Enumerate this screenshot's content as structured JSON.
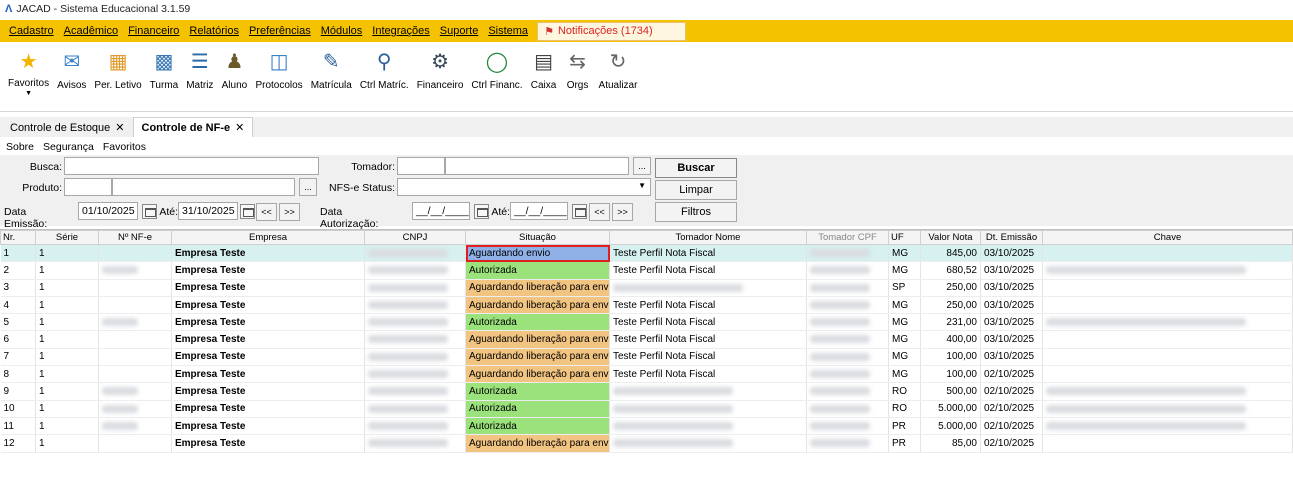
{
  "window": {
    "title": "JACAD - Sistema Educacional 3.1.59"
  },
  "menu": {
    "items": [
      "Cadastro",
      "Acadêmico",
      "Financeiro",
      "Relatórios",
      "Preferências",
      "Módulos",
      "Integrações",
      "Suporte",
      "Sistema"
    ],
    "notifications": "Notificações (1734)"
  },
  "toolbar": [
    {
      "label": "Favoritos",
      "icon": "star-icon"
    },
    {
      "label": "Avisos",
      "icon": "envelope-icon"
    },
    {
      "label": "Per. Letivo",
      "icon": "calendar-icon"
    },
    {
      "label": "Turma",
      "icon": "class-group-icon"
    },
    {
      "label": "Matriz",
      "icon": "matrix-icon"
    },
    {
      "label": "Aluno",
      "icon": "student-icon"
    },
    {
      "label": "Protocolos",
      "icon": "protocol-icon"
    },
    {
      "label": "Matrícula",
      "icon": "enrollment-icon"
    },
    {
      "label": "Ctrl Matríc.",
      "icon": "enrollment-control-icon"
    },
    {
      "label": "Financeiro",
      "icon": "finance-icon"
    },
    {
      "label": "Ctrl Financ.",
      "icon": "finance-control-icon"
    },
    {
      "label": "Caixa",
      "icon": "cash-register-icon"
    },
    {
      "label": "Orgs",
      "icon": "arrows-icon"
    },
    {
      "label": "Atualizar",
      "icon": "refresh-icon"
    }
  ],
  "tabs": [
    {
      "label": "Controle de Estoque"
    },
    {
      "label": "Controle de NF-e"
    }
  ],
  "submenu": [
    "Sobre",
    "Segurança",
    "Favoritos"
  ],
  "filters": {
    "busca_label": "Busca:",
    "busca_value": "",
    "produto_label": "Produto:",
    "data_emissao_label": "Data Emissão:",
    "data_emissao_de": "01/10/2025",
    "ate_label": "Até:",
    "data_emissao_ate": "31/10/2025",
    "tomador_label": "Tomador:",
    "nfse_status_label": "NFS-e Status:",
    "data_autorizacao_label": "Data Autorização:",
    "data_autorizacao_de": "__/__/____",
    "data_autorizacao_ate": "__/__/____",
    "ellipsis": "...",
    "prev": "<<",
    "next": ">>",
    "buscar": "Buscar",
    "limpar": "Limpar",
    "filtros": "Filtros"
  },
  "grid": {
    "columns": [
      "Nr.",
      "Série",
      "Nº NF-e",
      "Empresa",
      "CNPJ",
      "Situação",
      "Tomador Nome",
      "Tomador CPF",
      "UF",
      "Valor Nota",
      "Dt. Emissão",
      "Chave"
    ],
    "rows": [
      {
        "nr": "1",
        "serie": "1",
        "nf": "",
        "empresa": "Empresa Teste",
        "situacao": "Aguardando envio",
        "status": "envio",
        "tomador": "Teste Perfil Nota Fiscal",
        "uf": "MG",
        "valor": "845,00",
        "data": "03/10/2025"
      },
      {
        "nr": "2",
        "serie": "1",
        "nf": "",
        "empresa": "Empresa Teste",
        "situacao": "Autorizada",
        "status": "auto",
        "tomador": "Teste Perfil Nota Fiscal",
        "uf": "MG",
        "valor": "680,52",
        "data": "03/10/2025"
      },
      {
        "nr": "3",
        "serie": "1",
        "nf": "",
        "empresa": "Empresa Teste",
        "situacao": "Aguardando liberação para envio",
        "status": "lib",
        "tomador": "",
        "uf": "SP",
        "valor": "250,00",
        "data": "03/10/2025"
      },
      {
        "nr": "4",
        "serie": "1",
        "nf": "",
        "empresa": "Empresa Teste",
        "situacao": "Aguardando liberação para envio",
        "status": "lib",
        "tomador": "Teste Perfil Nota Fiscal",
        "uf": "MG",
        "valor": "250,00",
        "data": "03/10/2025"
      },
      {
        "nr": "5",
        "serie": "1",
        "nf": "",
        "empresa": "Empresa Teste",
        "situacao": "Autorizada",
        "status": "auto",
        "tomador": "Teste Perfil Nota Fiscal",
        "uf": "MG",
        "valor": "231,00",
        "data": "03/10/2025"
      },
      {
        "nr": "6",
        "serie": "1",
        "nf": "",
        "empresa": "Empresa Teste",
        "situacao": "Aguardando liberação para envio",
        "status": "lib",
        "tomador": "Teste Perfil Nota Fiscal",
        "uf": "MG",
        "valor": "400,00",
        "data": "03/10/2025"
      },
      {
        "nr": "7",
        "serie": "1",
        "nf": "",
        "empresa": "Empresa Teste",
        "situacao": "Aguardando liberação para envio",
        "status": "lib",
        "tomador": "Teste Perfil Nota Fiscal",
        "uf": "MG",
        "valor": "100,00",
        "data": "03/10/2025"
      },
      {
        "nr": "8",
        "serie": "1",
        "nf": "",
        "empresa": "Empresa Teste",
        "situacao": "Aguardando liberação para envio",
        "status": "lib",
        "tomador": "Teste Perfil Nota Fiscal",
        "uf": "MG",
        "valor": "100,00",
        "data": "02/10/2025"
      },
      {
        "nr": "9",
        "serie": "1",
        "nf": "",
        "empresa": "Empresa Teste",
        "situacao": "Autorizada",
        "status": "auto",
        "tomador": "",
        "uf": "RO",
        "valor": "500,00",
        "data": "02/10/2025"
      },
      {
        "nr": "10",
        "serie": "1",
        "nf": "",
        "empresa": "Empresa Teste",
        "situacao": "Autorizada",
        "status": "auto",
        "tomador": "",
        "uf": "RO",
        "valor": "5.000,00",
        "data": "02/10/2025"
      },
      {
        "nr": "11",
        "serie": "1",
        "nf": "",
        "empresa": "Empresa Teste",
        "situacao": "Autorizada",
        "status": "auto",
        "tomador": "",
        "uf": "PR",
        "valor": "5.000,00",
        "data": "02/10/2025"
      },
      {
        "nr": "12",
        "serie": "1",
        "nf": "",
        "empresa": "Empresa Teste",
        "situacao": "Aguardando liberação para envio",
        "status": "lib",
        "tomador": "",
        "uf": "PR",
        "valor": "85,00",
        "data": "02/10/2025"
      }
    ]
  },
  "colors": {
    "menu_bar": "#f5c200",
    "status_autorizada": "#9be27c",
    "status_liberacao": "#f2c481",
    "status_envio": "#8fb1e8",
    "selection_outline": "#e02020",
    "selected_row": "#d7f0f0"
  }
}
